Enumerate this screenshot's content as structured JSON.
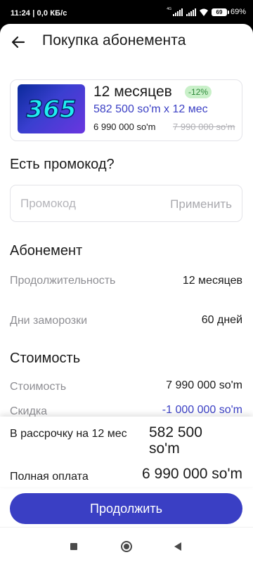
{
  "status_bar": {
    "time": "11:24",
    "speed": "| 0,0 КБ/с",
    "battery_percent": "69",
    "battery_label": "69%",
    "net_label": "4G"
  },
  "header": {
    "title": "Покупка абонемента"
  },
  "plan": {
    "logo_text": "365",
    "duration": "12 месяцев",
    "discount_badge": "-12%",
    "monthly": "582 500 so'm x 12 мес",
    "price": "6 990 000 so'm",
    "old_price": "7 990 000 so'm"
  },
  "promo": {
    "title": "Есть промокод?",
    "placeholder": "Промокод",
    "value": "",
    "apply_label": "Применить"
  },
  "subscription": {
    "title": "Абонемент",
    "rows": [
      {
        "label": "Продолжительность",
        "value": "12 месяцев"
      },
      {
        "label": "Дни заморозки",
        "value": "60 дней"
      }
    ]
  },
  "cost": {
    "title": "Стоимость",
    "rows": [
      {
        "label": "Стоимость",
        "value": "7 990 000 so'm"
      },
      {
        "label": "Скидка",
        "value": "-1 000 000 so'm"
      }
    ]
  },
  "summary": {
    "installment_label": "В рассрочку на 12 мес",
    "installment_value": "582 500 so'm",
    "full_label": "Полная оплата",
    "full_value": "6 990 000 so'm"
  },
  "continue_label": "Продолжить",
  "colors": {
    "accent": "#3a3fc4",
    "discount_badge_bg": "#c9f0c9",
    "discount_badge_text": "#2e8a3a",
    "muted": "#8e8e93"
  },
  "icons": {
    "back": "arrow-left-icon",
    "nav_recent": "square-icon",
    "nav_home": "circle-icon",
    "nav_back": "triangle-back-icon"
  }
}
